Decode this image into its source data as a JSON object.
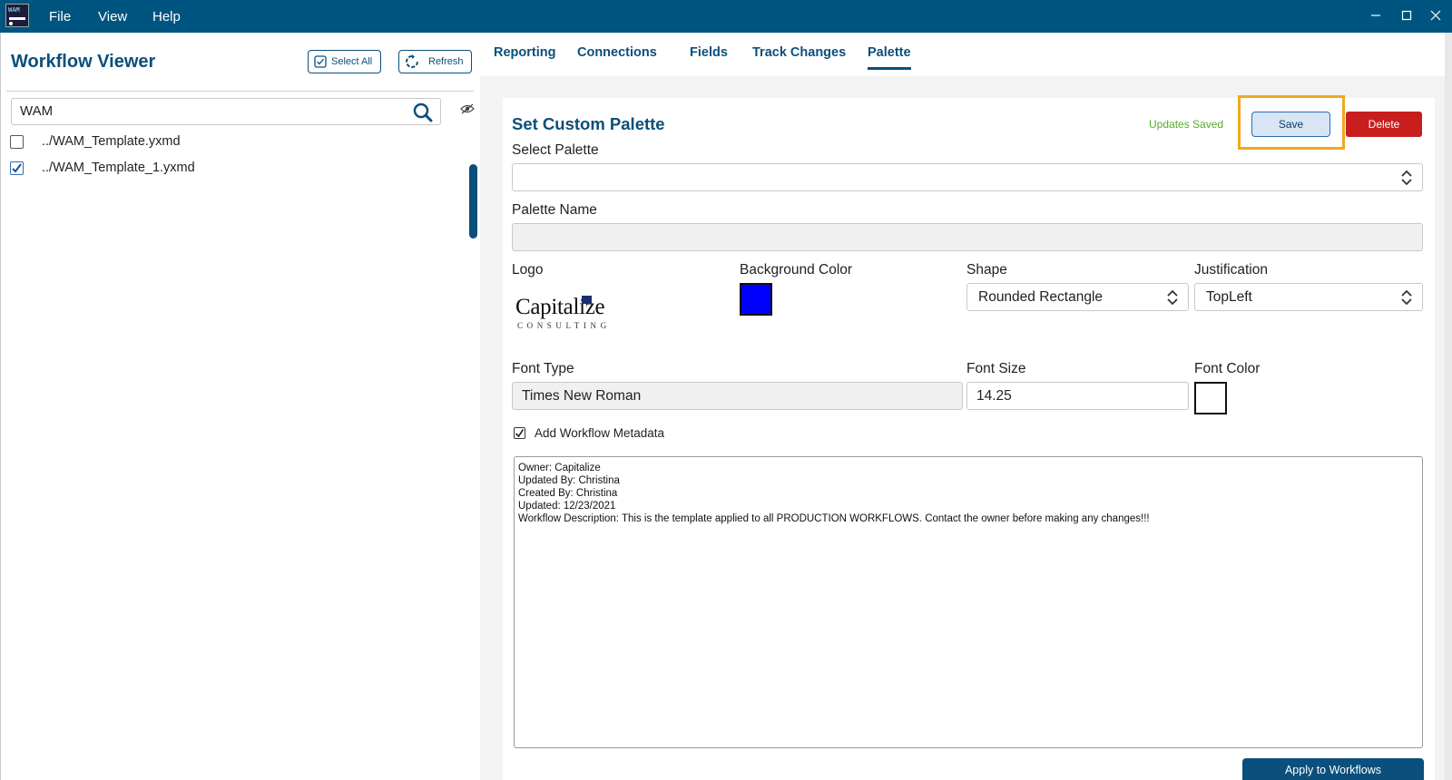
{
  "app": {
    "logo_text": "WAM",
    "menu": [
      "File",
      "View",
      "Help"
    ],
    "window_controls": [
      "minimize-icon",
      "maximize-icon",
      "close-icon"
    ]
  },
  "sidebar": {
    "title": "Workflow Viewer",
    "select_all_label": "Select All",
    "refresh_label": "Refresh",
    "search_value": "WAM",
    "files": [
      {
        "name": "../WAM_Template.yxmd",
        "checked": false
      },
      {
        "name": "../WAM_Template_1.yxmd",
        "checked": true
      }
    ]
  },
  "tabs": [
    {
      "label": "Reporting",
      "active": false
    },
    {
      "label": "Connections",
      "active": false
    },
    {
      "label": "Fields",
      "active": false
    },
    {
      "label": "Track Changes",
      "active": false
    },
    {
      "label": "Palette",
      "active": true
    }
  ],
  "palette": {
    "title": "Set Custom Palette",
    "status": "Updates Saved",
    "save_label": "Save",
    "delete_label": "Delete",
    "select_palette_label": "Select Palette",
    "select_palette_value": "",
    "palette_name_label": "Palette Name",
    "palette_name_value": "",
    "logo_label": "Logo",
    "logo_text": "Capitalize",
    "logo_subtext": "CONSULTING",
    "background_color_label": "Background Color",
    "background_color": "#0000ff",
    "shape_label": "Shape",
    "shape_value": "Rounded Rectangle",
    "justification_label": "Justification",
    "justification_value": "TopLeft",
    "font_type_label": "Font Type",
    "font_type_value": "Times New Roman",
    "font_size_label": "Font Size",
    "font_size_value": "14.25",
    "font_color_label": "Font Color",
    "font_color": "#ffffff",
    "add_metadata_label": "Add Workflow Metadata",
    "add_metadata_checked": true,
    "metadata_lines": [
      "Owner: Capitalize",
      "Updated By: Christina",
      "Created By: Christina",
      "Updated: 12/23/2021",
      "Workflow Description: This is the template applied to all PRODUCTION WORKFLOWS. Contact the owner before making any changes!!!"
    ],
    "apply_label": "Apply to Workflows"
  },
  "colors": {
    "title_bar": "#005580",
    "accent": "#0b4f7c",
    "delete": "#c81e1e",
    "highlight": "#f0a820",
    "status_green": "#5aaa2a"
  }
}
